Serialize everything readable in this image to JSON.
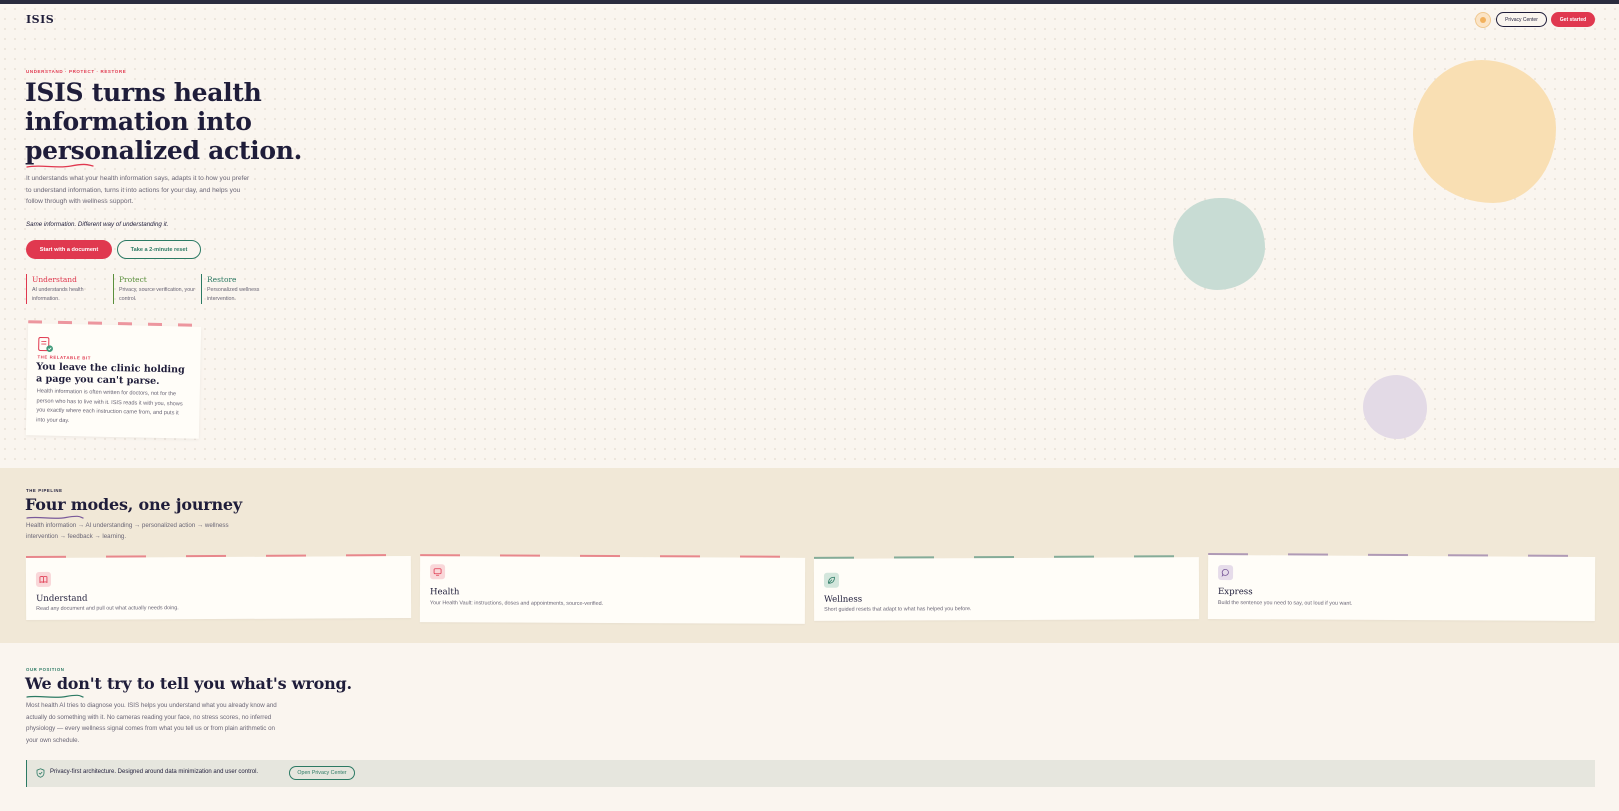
{
  "header": {
    "logo": "ISIS",
    "privacy_button": "Privacy Center",
    "cta_button": "Get started"
  },
  "hero": {
    "eyebrow": "UNDERSTAND · PROTECT · RESTORE",
    "title": "ISIS turns health information into personalized action.",
    "description": "It understands what your health information says, adapts it to how you prefer to understand information, turns it into actions for your day, and helps you follow through with wellness support.",
    "tagline": "Same information. Different way of understanding it.",
    "primary_button": "Start with a document",
    "secondary_button": "Take a 2-minute reset",
    "pillars": [
      {
        "title": "Understand",
        "desc": "AI understands health information.",
        "color": "#e0384f"
      },
      {
        "title": "Protect",
        "desc": "Privacy, source verification, your control.",
        "color": "#5a8f3c"
      },
      {
        "title": "Restore",
        "desc": "Personalized wellness intervention.",
        "color": "#2c7a64"
      }
    ]
  },
  "relatable": {
    "eyebrow": "THE RELATABLE BIT",
    "title": "You leave the clinic holding a page you can't parse.",
    "description": "Health information is often written for doctors, not for the person who has to live with it. ISIS reads it with you, shows you exactly where each instruction came from, and puts it into your day."
  },
  "pipeline": {
    "eyebrow": "THE PIPELINE",
    "title": "Four modes, one journey",
    "description": "Health information → AI understanding → personalized action → wellness intervention → feedback → learning.",
    "modes": [
      {
        "title": "Understand",
        "desc": "Read any document and pull out what actually needs doing.",
        "icon": "book-icon",
        "color": "#e0384f"
      },
      {
        "title": "Health",
        "desc": "Your Health Vault: instructions, doses and appointments, source-verified.",
        "icon": "heart-monitor-icon",
        "color": "#e0384f"
      },
      {
        "title": "Wellness",
        "desc": "Short guided resets that adapt to what has helped you before.",
        "icon": "leaf-icon",
        "color": "#2c7a64"
      },
      {
        "title": "Express",
        "desc": "Build the sentence you need to say, out loud if you want.",
        "icon": "chat-bubble-icon",
        "color": "#7a5a9a"
      }
    ]
  },
  "position": {
    "eyebrow": "OUR POSITION",
    "title": "We don't try to tell you what's wrong.",
    "description": "Most health AI tries to diagnose you. ISIS helps you understand what you already know and actually do something with it. No cameras reading your face, no stress scores, no inferred physiology — every wellness signal comes from what you tell us or from plain arithmetic on your own schedule.",
    "privacy_text": "Privacy-first architecture. Designed around data minimization and user control.",
    "privacy_button": "Open Privacy Center"
  },
  "colors": {
    "accent": "#e0384f",
    "green": "#2c7a64",
    "ink": "#1f1d3a",
    "background": "#faf5ef",
    "pipeline_bg": "#f1e8d7"
  }
}
